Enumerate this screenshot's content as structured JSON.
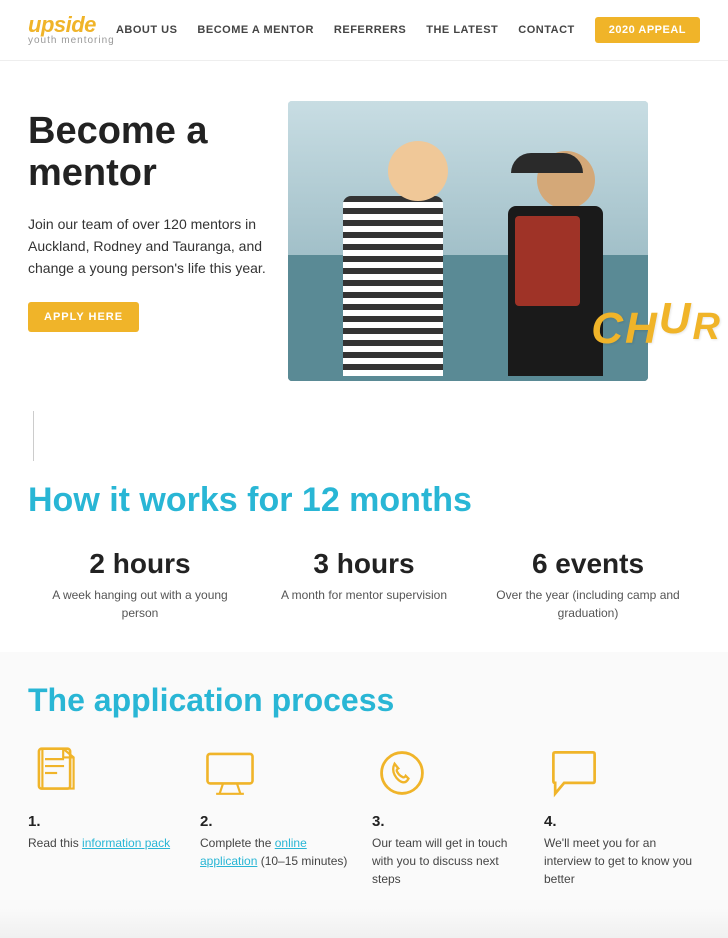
{
  "nav": {
    "logo_upside": "upside",
    "logo_sub": "youth mentoring",
    "links": [
      {
        "label": "ABOUT US",
        "id": "about-us"
      },
      {
        "label": "BECOME A MENTOR",
        "id": "become-mentor"
      },
      {
        "label": "REFERRERS",
        "id": "referrers"
      },
      {
        "label": "THE LATEST",
        "id": "the-latest"
      },
      {
        "label": "CONTACT",
        "id": "contact"
      }
    ],
    "appeal_label": "2020 APPEAL"
  },
  "hero": {
    "title": "Become a mentor",
    "description": "Join our team of over 120 mentors in Auckland, Rodney and Tauranga, and change a young person's life this year.",
    "apply_button": "APPLY HERE",
    "chur_letters": [
      "C",
      "H",
      "U",
      "R"
    ]
  },
  "how": {
    "title": "How it works for 12 months",
    "items": [
      {
        "number": "2 hours",
        "desc": "A week hanging out with a young person"
      },
      {
        "number": "3 hours",
        "desc": "A month for mentor supervision"
      },
      {
        "number": "6 events",
        "desc": "Over the year (including camp and graduation)"
      }
    ]
  },
  "application": {
    "title": "The application process",
    "steps": [
      {
        "num": "1.",
        "text_before": "Read this ",
        "link_text": "information pack",
        "text_after": ""
      },
      {
        "num": "2.",
        "text_before": "Complete the ",
        "link_text": "online application",
        "text_after": " (10–15 minutes)"
      },
      {
        "num": "3.",
        "text_before": "Our team will get in touch with you to discuss next steps",
        "link_text": "",
        "text_after": ""
      },
      {
        "num": "4.",
        "text_before": "We'll meet you for an interview to get to know you better",
        "link_text": "",
        "text_after": ""
      }
    ]
  }
}
